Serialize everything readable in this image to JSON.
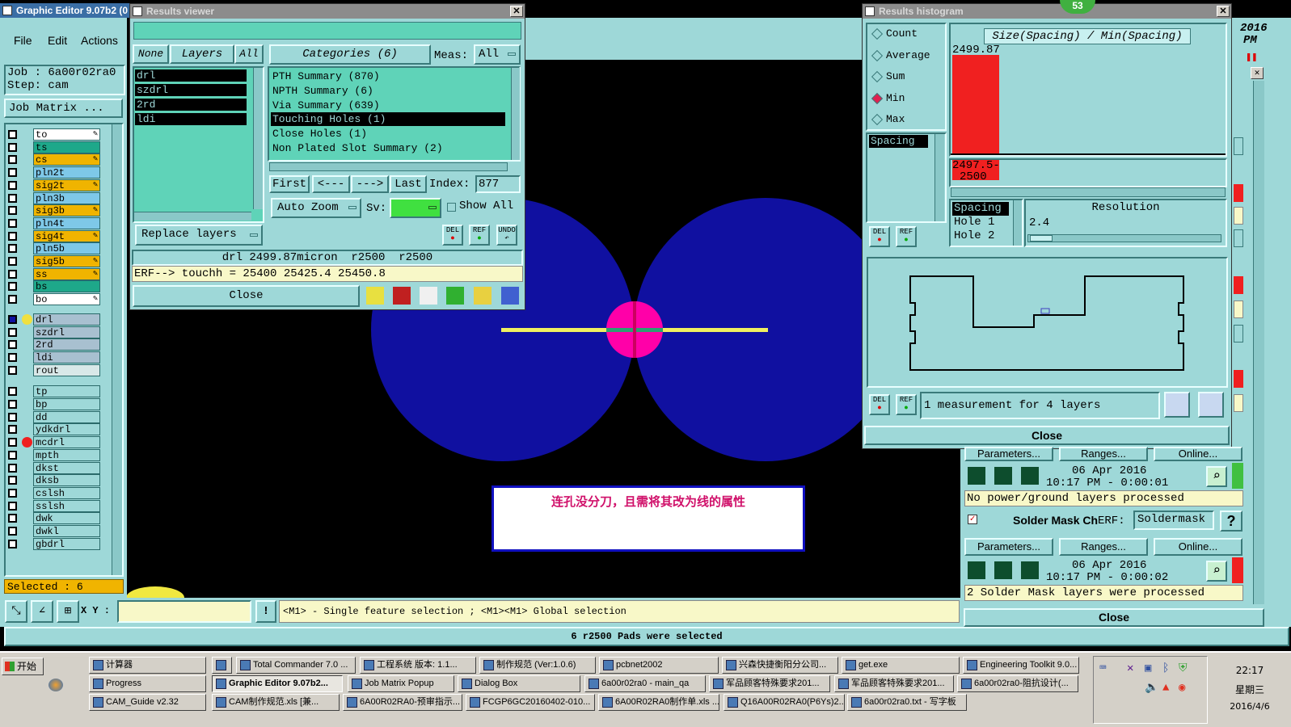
{
  "main_window": {
    "title": "Graphic Editor 9.07b2 (0",
    "menu": [
      "File",
      "Edit",
      "Actions"
    ],
    "job_label": "Job : 6a00r02ra0",
    "step_label": "Step: cam",
    "job_matrix_btn": "Job Matrix ...",
    "layers": [
      {
        "name": "to",
        "color": "#ffffff",
        "flag": true
      },
      {
        "name": "ts",
        "color": "#1ea88a",
        "flag": false
      },
      {
        "name": "cs",
        "color": "#f0b400",
        "flag": true
      },
      {
        "name": "pln2t",
        "color": "#7ec8e8",
        "flag": false
      },
      {
        "name": "sig2t",
        "color": "#f0b400",
        "flag": true
      },
      {
        "name": "pln3b",
        "color": "#7ec8e8",
        "flag": false
      },
      {
        "name": "sig3b",
        "color": "#f0b400",
        "flag": true
      },
      {
        "name": "pln4t",
        "color": "#7ec8e8",
        "flag": false
      },
      {
        "name": "sig4t",
        "color": "#f0b400",
        "flag": true
      },
      {
        "name": "pln5b",
        "color": "#7ec8e8",
        "flag": false
      },
      {
        "name": "sig5b",
        "color": "#f0b400",
        "flag": true
      },
      {
        "name": "ss",
        "color": "#f0b400",
        "flag": true
      },
      {
        "name": "bs",
        "color": "#1ea88a",
        "flag": false
      },
      {
        "name": "bo",
        "color": "#ffffff",
        "flag": true
      }
    ],
    "drill_layers": [
      {
        "name": "drl",
        "color": "#a8c0d0"
      },
      {
        "name": "szdrl",
        "color": "#a8c0d0"
      },
      {
        "name": "2rd",
        "color": "#a8c0d0"
      },
      {
        "name": "ldi",
        "color": "#a8c0d0"
      },
      {
        "name": "rout",
        "color": "#d8e8e8"
      }
    ],
    "other_layers": [
      "tp",
      "bp",
      "dd",
      "ydkdrl",
      "mcdrl",
      "mpth",
      "dkst",
      "dksb",
      "cslsh",
      "sslsh",
      "dwk",
      "dwkl",
      "gbdrl"
    ],
    "selected_count": "Selected : 6",
    "xy_label": "X Y :",
    "hint": "<M1> - Single feature selection ; <M1><M1> Global selection",
    "status": "6 r2500 Pads were selected",
    "annotation": "连孔没分刀，且需将其改为线的属性"
  },
  "results_viewer": {
    "title": "Results viewer",
    "tabs": [
      "None",
      "Layers",
      "All"
    ],
    "layers": [
      "drl",
      "szdrl",
      "2rd",
      "ldi"
    ],
    "categories_header": "Categories (6)",
    "meas_label": "Meas:",
    "meas_value": "All",
    "categories": [
      "PTH Summary (870)",
      "NPTH Summary (6)",
      "Via Summary (639)",
      "Touching Holes (1)",
      "Close Holes (1)",
      "Non Plated Slot Summary (2)"
    ],
    "nav": {
      "first": "First",
      "prev": "<---",
      "next": "--->",
      "last": "Last",
      "index_label": "Index:",
      "index_value": "877"
    },
    "auto_zoom": "Auto Zoom",
    "sv_label": "Sv:",
    "show_all": "Show All",
    "replace_layers": "Replace layers",
    "del": "DEL",
    "ref": "REF",
    "undo": "UNDO",
    "info1": "drl 2499.87micron  r2500  r2500",
    "info2": "ERF--> touchh = 25400 25425.4 25450.8",
    "close": "Close"
  },
  "histogram": {
    "title": "Results histogram",
    "badge": "53",
    "radios": [
      {
        "label": "Count",
        "on": false
      },
      {
        "label": "Average",
        "on": false
      },
      {
        "label": "Sum",
        "on": false
      },
      {
        "label": "Min",
        "on": true
      },
      {
        "label": "Max",
        "on": false
      }
    ],
    "measure_item": "Spacing",
    "chart_title": "Size(Spacing) / Min(Spacing)",
    "top_value": "2499.87",
    "range_label": "2497.5-",
    "range_label2": "2500",
    "spacing_list": [
      "Spacing",
      "Hole 1",
      "Hole 2"
    ],
    "resolution_label": "Resolution",
    "resolution_value": "2.4",
    "summary": "1 measurement for 4 layers",
    "close": "Close",
    "chart_data": {
      "type": "bar",
      "categories": [
        "2497.5-2500"
      ],
      "values": [
        1
      ],
      "title": "Size(Spacing) / Min(Spacing)"
    }
  },
  "right_panel": {
    "year": "2016",
    "pm": "PM",
    "params": "Parameters...",
    "ranges": "Ranges...",
    "online": "Online...",
    "ts1": "06 Apr 2016",
    "ts1b": "10:17 PM - 0:00:01",
    "msg1": "No power/ground layers processed",
    "solder_label": "Solder Mask Ch",
    "erf_label": "ERF:",
    "erf_value": "Soldermask",
    "help": "?",
    "ts2": "06 Apr 2016",
    "ts2b": "10:17 PM - 0:00:02",
    "msg2": "2 Solder Mask layers were processed",
    "close": "Close"
  },
  "taskbar": {
    "start": "开始",
    "row1": [
      "计算器",
      "",
      "Total Commander 7.0 ...",
      "工程系统  版本: 1.1...",
      "制作规范 (Ver:1.0.6)",
      "pcbnet2002",
      "兴森快捷衡阳分公司...",
      "get.exe",
      "Engineering Toolkit 9.0..."
    ],
    "row2": [
      "Progress",
      "Graphic Editor 9.07b2...",
      "Job Matrix Popup",
      "Dialog Box",
      "6a00r02ra0 - main_qa",
      "军品顾客特殊要求201...",
      "军品顾客特殊要求201...",
      "6a00r02ra0-阻抗设计(..."
    ],
    "row3": [
      "CAM_Guide v2.32",
      "CAM制作规范.xls [兼...",
      "6A00R02RA0-预审指示...",
      "FCGP6GC20160402-010...",
      "6A00R02RA0制作单.xls ...",
      "Q16A00R02RA0(P6Ys)2...",
      "6a00r02ra0.txt - 写字板"
    ],
    "time": "22:17",
    "weekday": "星期三",
    "date": "2016/4/6"
  }
}
